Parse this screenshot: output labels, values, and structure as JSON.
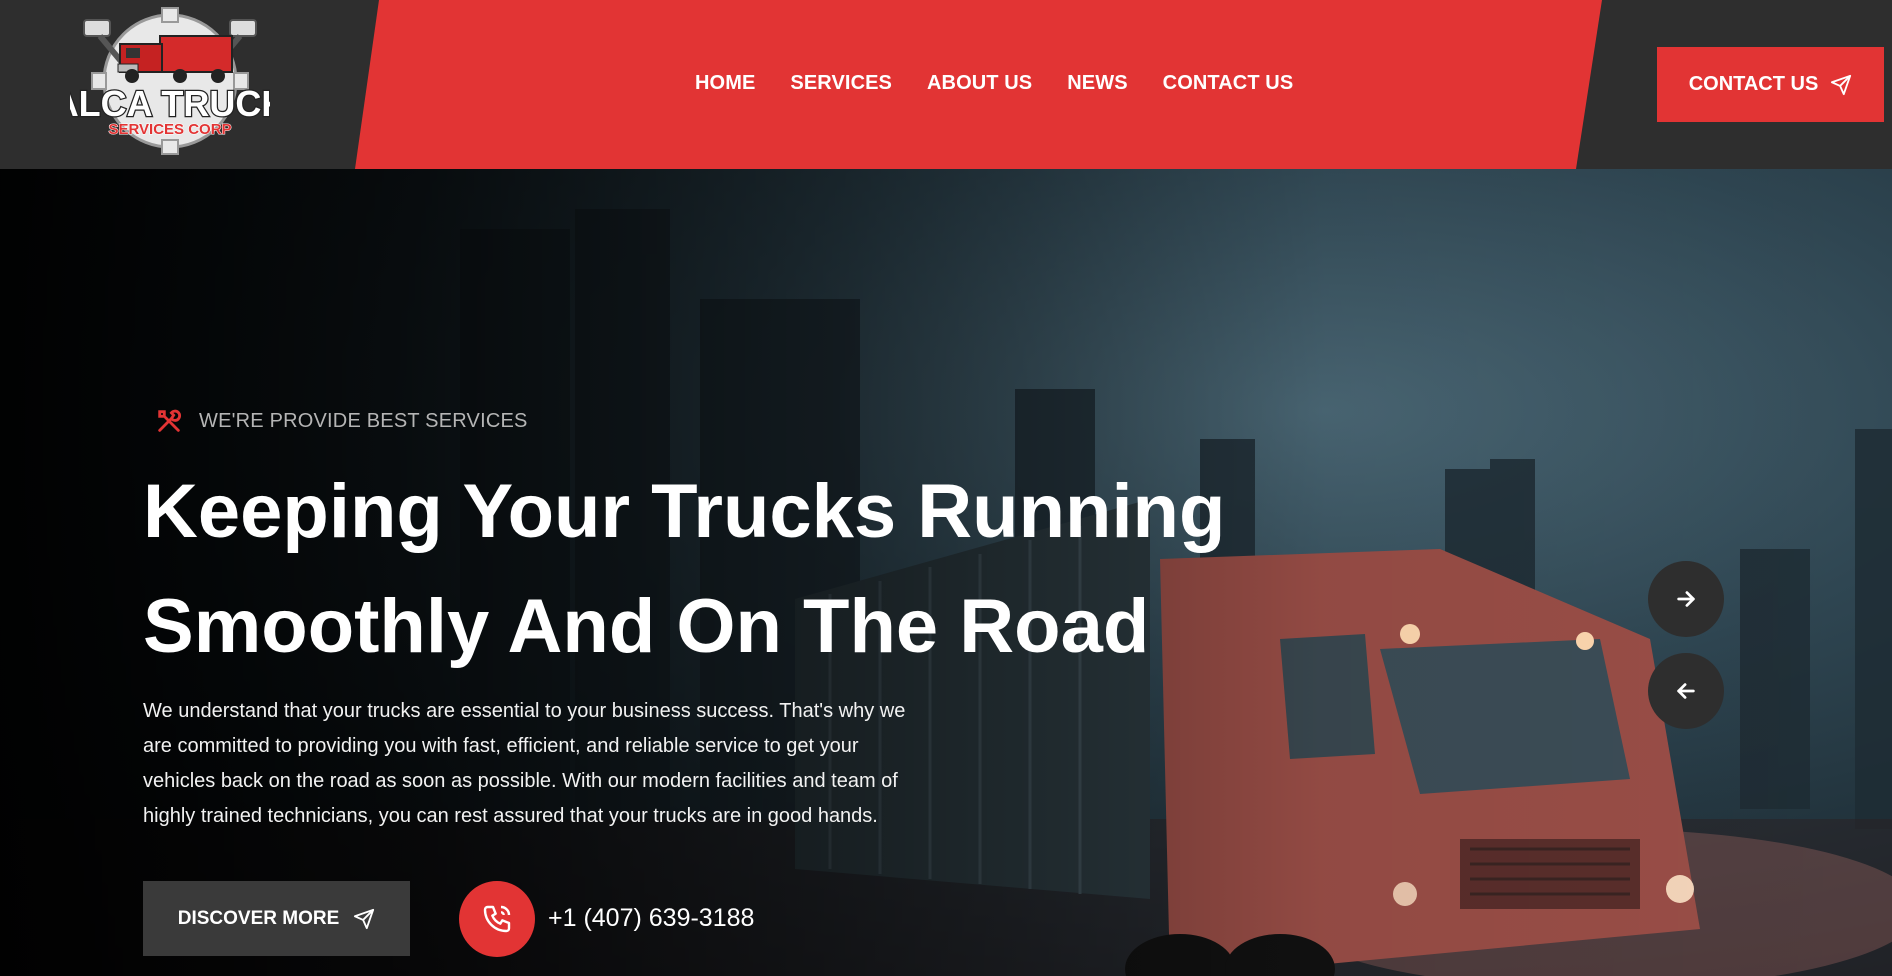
{
  "brand": {
    "line1": "ALCA TRUCK",
    "line2": "SERVICES CORP"
  },
  "nav": {
    "items": [
      {
        "label": "HOME"
      },
      {
        "label": "SERVICES"
      },
      {
        "label": "ABOUT US"
      },
      {
        "label": "NEWS"
      },
      {
        "label": "CONTACT US"
      }
    ],
    "cta_label": "CONTACT US"
  },
  "hero": {
    "eyebrow": "WE'RE PROVIDE BEST SERVICES",
    "title_line1": "Keeping Your Trucks Running",
    "title_line2": "Smoothly And On The Road",
    "description": "We understand that your trucks are essential to your business success. That's why we are committed to providing you with fast, efficient, and reliable service to get your vehicles back on the road as soon as possible. With our modern facilities and team of highly trained technicians, you can rest assured that your trucks are in good hands.",
    "discover_label": "DISCOVER MORE",
    "phone": "+1 (407) 639-3188"
  },
  "colors": {
    "accent": "#e23434",
    "header_bg": "#2e2e2e",
    "button_dark": "#3a3a3a"
  },
  "icons": [
    "tools-icon",
    "paper-plane-icon",
    "phone-icon",
    "arrow-right-icon",
    "arrow-left-icon",
    "logo-truck-icon"
  ]
}
